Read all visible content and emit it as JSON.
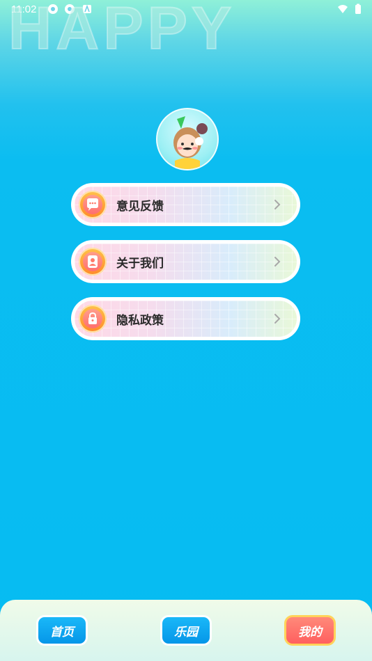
{
  "status_bar": {
    "time": "11:02"
  },
  "banner": {
    "text": "HAPPY"
  },
  "menu": [
    {
      "label": "意见反馈",
      "icon": "chat-bubble-icon"
    },
    {
      "label": "关于我们",
      "icon": "person-icon"
    },
    {
      "label": "隐私政策",
      "icon": "lock-icon"
    }
  ],
  "tabs": [
    {
      "label": "首页",
      "active": false
    },
    {
      "label": "乐园",
      "active": false
    },
    {
      "label": "我的",
      "active": true
    }
  ],
  "colors": {
    "accent": "#06bcf2",
    "active_tab": "#ff6f6f"
  }
}
